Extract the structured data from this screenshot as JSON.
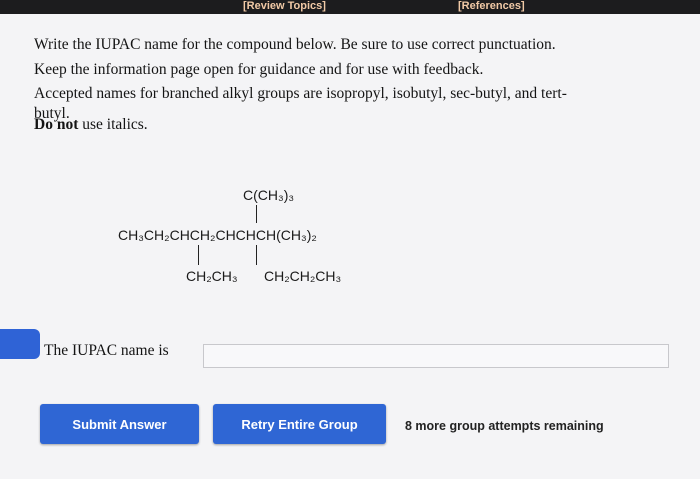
{
  "top_bar": {
    "review_topics": "[Review Topics]",
    "references": "[References]"
  },
  "instructions": {
    "line1": "Write the IUPAC name for the compound below. Be sure to use correct punctuation.",
    "line2": "Keep the information page open for guidance and for use with feedback.",
    "line3": "Accepted names for branched alkyl groups are isopropyl, isobutyl, sec-butyl, and tert-",
    "line4": "butyl.",
    "warning_bold": "Do not",
    "warning_rest": " use italics."
  },
  "structure": {
    "top_substituent": "C(CH₃)₃",
    "main_chain": "CH₃CH₂CHCH₂CHCHCH(CH₃)₂",
    "bottom_left": "CH₂CH₃",
    "bottom_right": "CH₂CH₂CH₃"
  },
  "answer": {
    "label": "The IUPAC name is",
    "value": ""
  },
  "buttons": {
    "submit": "Submit Answer",
    "retry": "Retry Entire Group"
  },
  "status": {
    "remaining": "8 more group attempts remaining"
  },
  "colors": {
    "accent": "#2f66d4",
    "top_bar": "#1c1c1e",
    "tab_text": "#f0c9a6"
  }
}
